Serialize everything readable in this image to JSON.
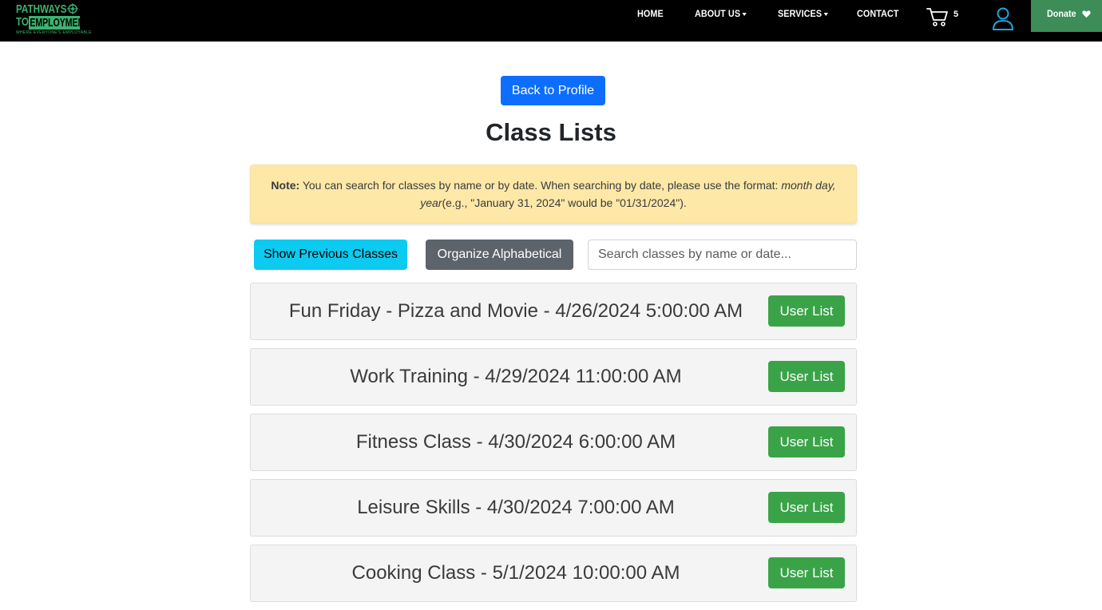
{
  "logo": {
    "line1": "PATHWAYS",
    "line2a": "TO",
    "line2b": "EMPLOYMENT",
    "tagline": "WHERE EVERYONE'S EMPLOYABLE",
    "icon": "compass-emblem-icon"
  },
  "nav": {
    "home": "HOME",
    "about": "ABOUT US",
    "services": "SERVICES",
    "contact": "CONTACT",
    "cart_count": "5",
    "cart_icon": "shopping-cart-icon",
    "user_icon": "user-icon",
    "donate": "Donate",
    "donate_icon": "heart-icon"
  },
  "colors": {
    "navbar_bg": "#000000",
    "brand_green": "#3cb371",
    "donate_bg": "#3c8d57",
    "primary": "#0d6efd",
    "info": "#0dcaf0",
    "secondary": "#5c636a",
    "success": "#3aa348",
    "note_bg": "#fde8a8"
  },
  "back_button": "Back to Profile",
  "page_title": "Class Lists",
  "note": {
    "label": "Note:",
    "text": " You can search for classes by name or by date. When searching by date, please use the format: ",
    "format": "month day, year",
    "example": "(e.g., \"January 31, 2024\" would be \"01/31/2024\")."
  },
  "controls": {
    "show_previous": "Show Previous Classes",
    "organize": "Organize Alphabetical",
    "search_placeholder": "Search classes by name or date..."
  },
  "classes": [
    {
      "title": "Fun Friday - Pizza and Movie - 4/26/2024 5:00:00 AM",
      "button": "User List"
    },
    {
      "title": "Work Training - 4/29/2024 11:00:00 AM",
      "button": "User List"
    },
    {
      "title": "Fitness Class - 4/30/2024 6:00:00 AM",
      "button": "User List"
    },
    {
      "title": "Leisure Skills - 4/30/2024 7:00:00 AM",
      "button": "User List"
    },
    {
      "title": "Cooking Class - 5/1/2024 10:00:00 AM",
      "button": "User List"
    }
  ]
}
